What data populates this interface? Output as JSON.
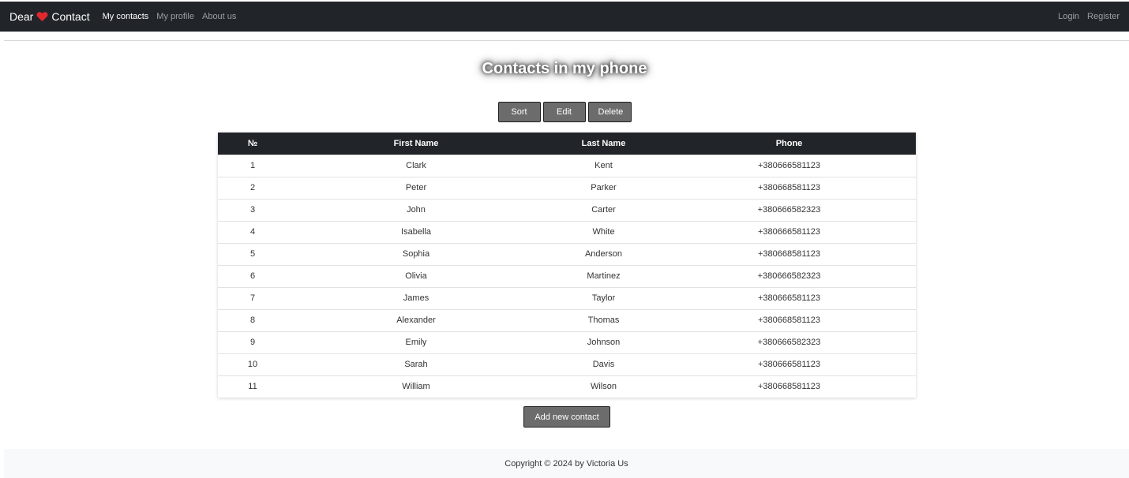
{
  "navbar": {
    "brand_prefix": "Dear",
    "brand_suffix": "Contact",
    "brand_icon": "heart-icon",
    "links": [
      {
        "label": "My contacts",
        "active": true
      },
      {
        "label": "My profile",
        "active": false
      },
      {
        "label": "About us",
        "active": false
      }
    ],
    "auth": {
      "login": "Login",
      "register": "Register"
    }
  },
  "main": {
    "title": "Contacts in my phone",
    "actions": {
      "sort": "Sort",
      "edit": "Edit",
      "delete": "Delete"
    },
    "add_button": "Add new contact"
  },
  "table": {
    "headers": [
      "№",
      "First Name",
      "Last Name",
      "Phone"
    ],
    "rows": [
      [
        "1",
        "Clark",
        "Kent",
        "+380666581123"
      ],
      [
        "2",
        "Peter",
        "Parker",
        "+380668581123"
      ],
      [
        "3",
        "John",
        "Carter",
        "+380666582323"
      ],
      [
        "4",
        "Isabella",
        "White",
        "+380666581123"
      ],
      [
        "5",
        "Sophia",
        "Anderson",
        "+380668581123"
      ],
      [
        "6",
        "Olivia",
        "Martinez",
        "+380666582323"
      ],
      [
        "7",
        "James",
        "Taylor",
        "+380666581123"
      ],
      [
        "8",
        "Alexander",
        "Thomas",
        "+380668581123"
      ],
      [
        "9",
        "Emily",
        "Johnson",
        "+380666582323"
      ],
      [
        "10",
        "Sarah",
        "Davis",
        "+380666581123"
      ],
      [
        "11",
        "William",
        "Wilson",
        "+380668581123"
      ]
    ]
  },
  "footer": {
    "copyright": "Copyright © 2024 by Victoria Us"
  },
  "colors": {
    "navbar_bg": "#212529",
    "heart": "#e0282e",
    "button_bg": "#6c6c6c"
  }
}
